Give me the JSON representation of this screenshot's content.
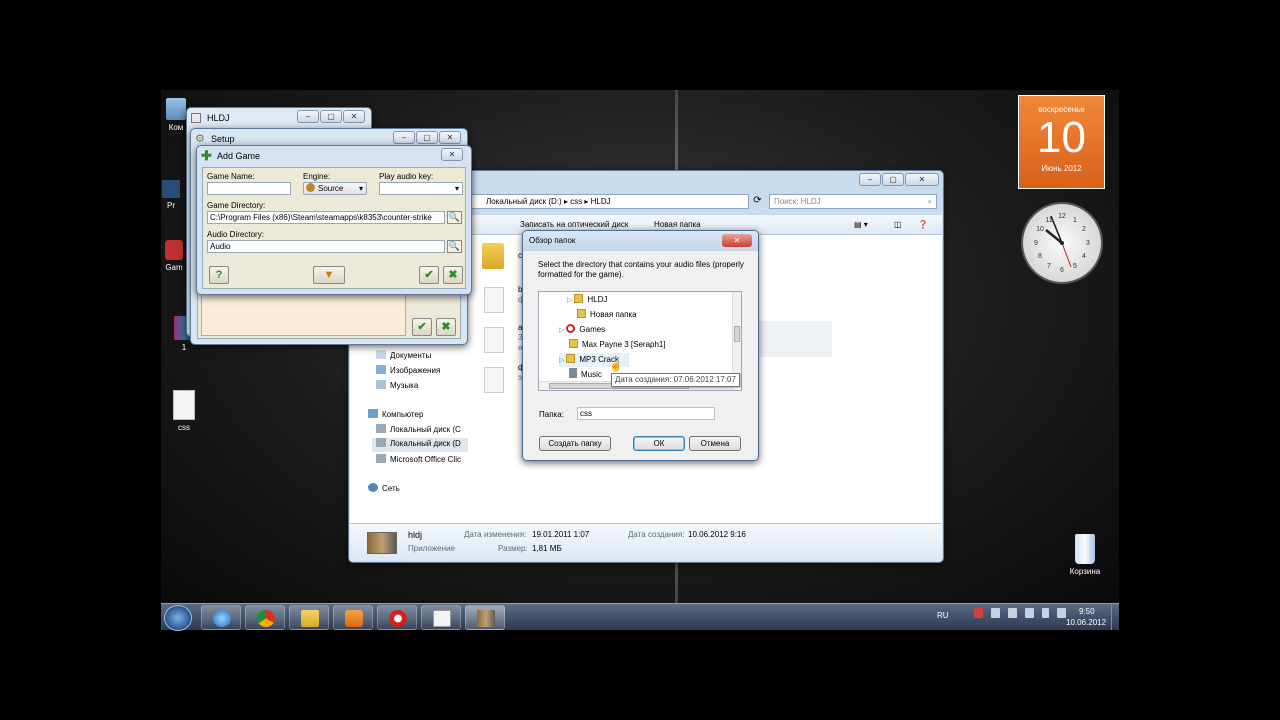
{
  "desktop": {
    "icons": [
      {
        "label": "Ком",
        "name": "computer"
      },
      {
        "label": "Pr",
        "name": "program"
      },
      {
        "label": "Gam",
        "name": "games"
      },
      {
        "label": "1",
        "name": "winrar-1"
      },
      {
        "label": "css",
        "name": "css-file"
      }
    ],
    "recycle_bin": "Корзина"
  },
  "calendar": {
    "weekday": "воскресенье",
    "day": "10",
    "month_year": "Июнь 2012"
  },
  "hldj": {
    "title": "HLDJ"
  },
  "setup": {
    "title": "Setup"
  },
  "add_game": {
    "title": "Add Game",
    "game_name_label": "Game Name:",
    "game_name_value": "",
    "engine_label": "Engine:",
    "engine_value": "Source",
    "play_key_label": "Play audio key:",
    "play_key_value": "",
    "game_dir_label": "Game Directory:",
    "game_dir_value": "C:\\Program Files (x86)\\Steam\\steamapps\\k8353\\counter-strike",
    "audio_dir_label": "Audio Directory:",
    "audio_dir_value": "Audio",
    "help_button": "?",
    "down_button": "▼",
    "ok_button": "✔",
    "cancel_button": "✖"
  },
  "explorer": {
    "address": [
      "Локальный диск (D:)",
      "css",
      "HLDJ"
    ],
    "search_placeholder": "Поиск: HLDJ",
    "toolbar": [
      "Записать на оптический диск",
      "Новая папка"
    ],
    "nav": [
      "Документы",
      "Изображения",
      "Музыка",
      "Компьютер",
      "Локальный диск (C",
      "Локальный диск (D",
      "Microsoft Office Clic",
      "Сеть"
    ],
    "partial_items": [
      "с",
      "b",
      "ф",
      "а",
      "3",
      "а",
      "ф",
      "э"
    ],
    "details": {
      "name": "hldj",
      "type": "Приложение",
      "modified_label": "Дата изменения:",
      "modified_value": "19.01.2011 1:07",
      "size_label": "Размер:",
      "size_value": "1,81 МБ",
      "created_label": "Дата создания:",
      "created_value": "10.06.2012 9:16"
    }
  },
  "browse": {
    "title": "Обзор папок",
    "description": "Select the directory that contains your audio files (properly formatted for the game).",
    "tree": [
      {
        "label": "HLDJ",
        "depth": 2,
        "icon": "folder"
      },
      {
        "label": "Новая папка",
        "depth": 2,
        "icon": "folder"
      },
      {
        "label": "Games",
        "depth": 1,
        "icon": "blocked"
      },
      {
        "label": "Max Payne 3 [Seraph1]",
        "depth": 1,
        "icon": "folder"
      },
      {
        "label": "MP3 Crack",
        "depth": 1,
        "icon": "folder"
      },
      {
        "label": "Music",
        "depth": 1,
        "icon": "music"
      }
    ],
    "tooltip": "Дата создания: 07.06.2012 17:07",
    "folder_label": "Папка:",
    "folder_value": "css",
    "new_folder_button": "Создать папку",
    "ok_button": "ОК",
    "cancel_button": "Отмена"
  },
  "taskbar": {
    "lang": "RU",
    "time": "9:50",
    "date": "10.06.2012"
  },
  "colors": {
    "calendar_orange": "#e8741c",
    "taskbar": "#3b4a63",
    "dialog_ok_border": "#3c7fb1"
  }
}
